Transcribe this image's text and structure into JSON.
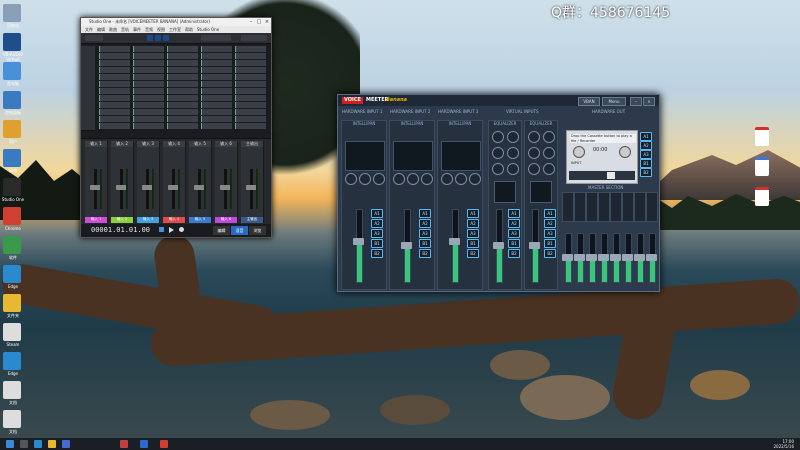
{
  "watermark": "Q群：458676145",
  "desktop_icons_left": [
    {
      "label": "回收站",
      "icon": "recycle-bin-icon",
      "color": "#8aa0b8"
    },
    {
      "label": "VB-AUDIO Virtual",
      "icon": "vb-audio-icon",
      "color": "#1e4f8a"
    },
    {
      "label": "此电脑",
      "icon": "computer-icon",
      "color": "#4a90d9"
    },
    {
      "label": "控制面板",
      "icon": "control-panel-icon",
      "color": "#3a7ac0"
    },
    {
      "label": "用户",
      "icon": "user-icon",
      "color": "#e0a030"
    },
    {
      "label": "网络",
      "icon": "network-icon",
      "color": "#3a7ac0"
    },
    {
      "label": "Studio One",
      "icon": "studio-one-icon",
      "color": "#2a2a2a"
    },
    {
      "label": "Chrome",
      "icon": "chrome-icon",
      "color": "#d04030"
    },
    {
      "label": "软件",
      "icon": "app-icon",
      "color": "#3a9a4a"
    },
    {
      "label": "Edge",
      "icon": "edge-icon",
      "color": "#2a8ad0"
    },
    {
      "label": "文件夹",
      "icon": "folder-icon",
      "color": "#e8b830"
    },
    {
      "label": "Steam",
      "icon": "steam-icon",
      "color": "#ddd"
    },
    {
      "label": "Edge",
      "icon": "edge-icon",
      "color": "#2a8ad0"
    },
    {
      "label": "文档",
      "icon": "document-icon",
      "color": "#ddd"
    },
    {
      "label": "文档",
      "icon": "document-icon",
      "color": "#ddd"
    }
  ],
  "daw": {
    "title": "Studio One - 未命名 [VOICEMEETER BANANA] (Administrator)",
    "menu": [
      "文件",
      "编辑",
      "歌曲",
      "音轨",
      "事件",
      "音频",
      "视图",
      "工作室",
      "帮助",
      "Studio One"
    ],
    "channels": [
      {
        "name": "输入 1",
        "color": "#d04adc"
      },
      {
        "name": "输入 2",
        "color": "#8ad040"
      },
      {
        "name": "输入 3",
        "color": "#40a0e0"
      },
      {
        "name": "输入 4",
        "color": "#e04a4a"
      },
      {
        "name": "输入 5",
        "color": "#3a7ad0"
      },
      {
        "name": "输入 6",
        "color": "#c04adc"
      },
      {
        "name": "主输出",
        "color": "#3a5a8a"
      }
    ],
    "timecode": "00001.01.01.00",
    "bottom_tabs": [
      "编辑",
      "混音",
      "浏览"
    ]
  },
  "voicemeeter": {
    "logo_voice": "VOICE",
    "logo_meeter": "MEETER",
    "logo_banana": "Banana",
    "top_btn_menu": "Menu",
    "top_btn_vban": "VBAN",
    "sections": [
      "HARDWARE INPUT 1",
      "HARDWARE INPUT 2",
      "HARDWARE INPUT 3",
      "VIRTUAL INPUTS",
      "HARDWARE OUT"
    ],
    "strip_labels": [
      "INTELLIPAN",
      "INTELLIPAN",
      "INTELLIPAN",
      "EQUALIZER",
      "EQUALIZER"
    ],
    "bus_labels": [
      "A1",
      "A2",
      "A3",
      "B1",
      "B2"
    ],
    "master_label": "MASTER SECTION",
    "recorder_text": "Drop the Cassette button to play a file / Recorder",
    "recorder_time": "00:00",
    "recorder_input": "INPUT",
    "mic_label": "MIC",
    "tape_label": "TAPE",
    "mono_label": "mono",
    "solo_label": "solo",
    "mute_label": "mute",
    "fader_levels": [
      0.55,
      0.5,
      0.55,
      0.5,
      0.5
    ],
    "master_levels": [
      0.5,
      0.5,
      0.5,
      0.5,
      0.5,
      0.5,
      0.5,
      0.5
    ]
  },
  "taskbar": {
    "time": "17:00",
    "date": "2022/5/16"
  }
}
